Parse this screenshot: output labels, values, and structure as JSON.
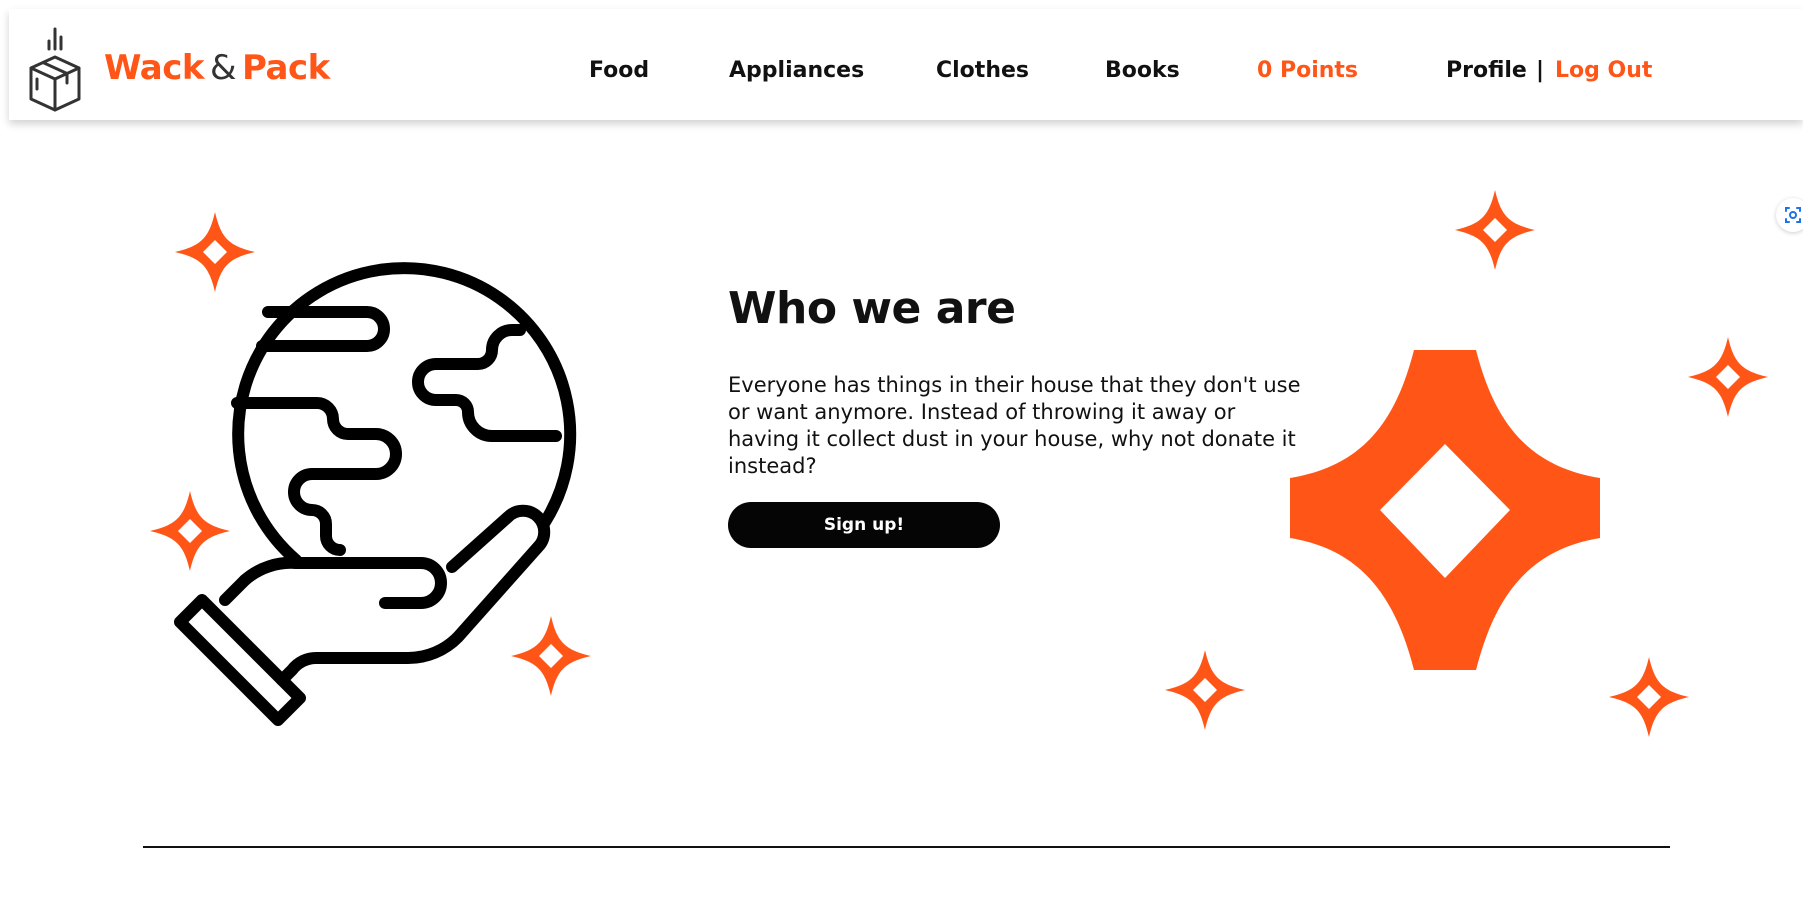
{
  "brand": {
    "word1": "Wack",
    "amp": "&",
    "word2": "Pack",
    "accent_color": "#ff5618",
    "logo_icon": "package-box-icon"
  },
  "nav": {
    "food": "Food",
    "appliances": "Appliances",
    "clothes": "Clothes",
    "books": "Books",
    "points": "0 Points",
    "profile": "Profile",
    "separator": "|",
    "logout": "Log Out"
  },
  "hero": {
    "title": "Who we are",
    "text": "Everyone has things in their house that they don't use or want anymore. Instead of throwing it away or having it collect dust in your house, why not donate it instead?",
    "button_label": "Sign up!",
    "illustration": "hand-holding-globe-icon",
    "decoration": "sparkle-icon"
  },
  "colors": {
    "accent": "#ff5618",
    "text": "#111111",
    "button_bg": "#050505",
    "background": "#ffffff"
  }
}
